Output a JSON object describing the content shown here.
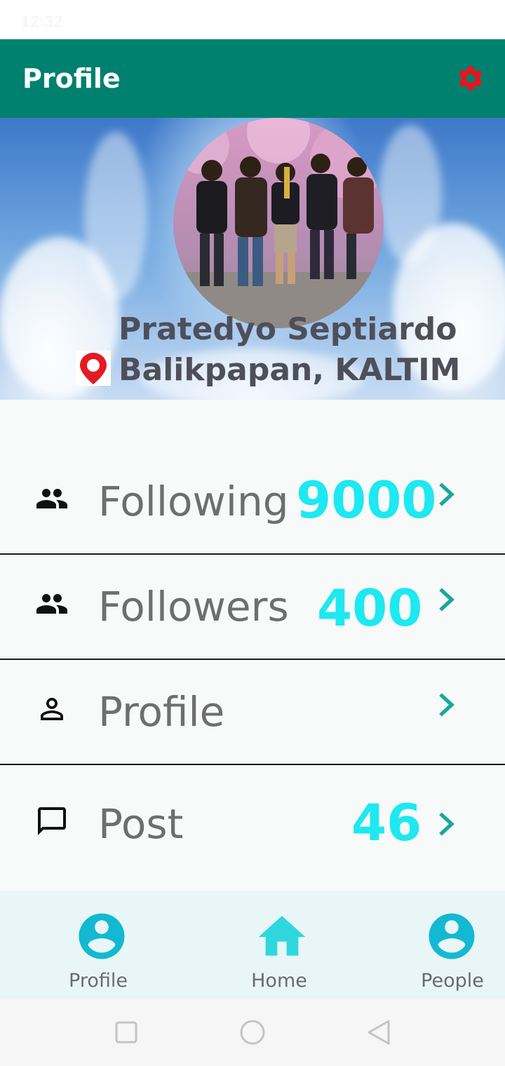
{
  "status_bar": {
    "time": "12:32",
    "system_text": ""
  },
  "app_bar": {
    "title": "Profile",
    "settings_icon": "gear-icon",
    "settings_color": "#e8141e",
    "background": "#00806e"
  },
  "profile": {
    "name": "Pratedyo Septiardo",
    "location": "Balikpapan, KALTIM",
    "location_icon": "location-pin-icon"
  },
  "menu": {
    "items": [
      {
        "icon": "people-icon",
        "label": "Following",
        "count": "9000"
      },
      {
        "icon": "people-icon",
        "label": "Followers",
        "count": "400"
      },
      {
        "icon": "person-icon",
        "label": "Profile",
        "count": ""
      },
      {
        "icon": "comment-icon",
        "label": "Post",
        "count": "46"
      }
    ],
    "count_color": "#1ee8f0"
  },
  "bottom_nav": {
    "items": [
      {
        "icon": "account-circle-icon",
        "label": "Profile"
      },
      {
        "icon": "home-icon",
        "label": "Home"
      },
      {
        "icon": "account-circle-icon",
        "label": "People"
      }
    ],
    "icon_color": "#13b9d2"
  },
  "system_nav": {
    "items": [
      "recents-button",
      "home-button",
      "back-button"
    ]
  }
}
